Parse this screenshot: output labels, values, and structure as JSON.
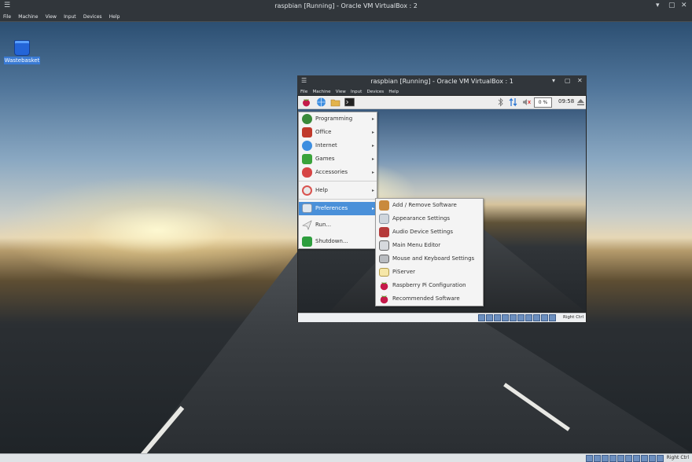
{
  "outer_window": {
    "title": "raspbian [Running] - Oracle VM VirtualBox : 2",
    "menu": [
      "File",
      "Machine",
      "View",
      "Input",
      "Devices",
      "Help"
    ],
    "controls": [
      "minimize-icon",
      "maximize-icon",
      "close-icon"
    ]
  },
  "outer_desktop": {
    "icons": [
      {
        "label": "Wastebasket",
        "icon": "trash-icon"
      }
    ]
  },
  "outer_status": {
    "host_key": "Right Ctrl"
  },
  "inner_window": {
    "title": "raspbian [Running] - Oracle VM VirtualBox : 1",
    "menu": [
      "File",
      "Machine",
      "View",
      "Input",
      "Devices",
      "Help"
    ],
    "controls": [
      "minimize-icon",
      "maximize-icon",
      "close-icon"
    ]
  },
  "panel": {
    "launchers": [
      "raspberry-menu-icon",
      "web-browser-icon",
      "file-manager-icon",
      "terminal-icon"
    ],
    "tray": [
      "bluetooth-icon",
      "network-icon",
      "volume-muted-icon"
    ],
    "cpu_label": "0 %",
    "clock": "09:58",
    "eject_icon": "eject-icon"
  },
  "app_menu": {
    "items": [
      {
        "label": "Programming",
        "icon": "programming-icon",
        "submenu": true
      },
      {
        "label": "Office",
        "icon": "office-icon",
        "submenu": true
      },
      {
        "label": "Internet",
        "icon": "internet-icon",
        "submenu": true
      },
      {
        "label": "Games",
        "icon": "games-icon",
        "submenu": true
      },
      {
        "label": "Accessories",
        "icon": "accessories-icon",
        "submenu": true
      },
      {
        "label": "Help",
        "icon": "help-icon",
        "submenu": true
      },
      {
        "label": "Preferences",
        "icon": "preferences-icon",
        "submenu": true,
        "selected": true
      },
      {
        "label": "Run...",
        "icon": "run-icon",
        "submenu": false
      },
      {
        "label": "Shutdown...",
        "icon": "shutdown-icon",
        "submenu": false
      }
    ]
  },
  "preferences_submenu": {
    "items": [
      {
        "label": "Add / Remove Software",
        "icon": "package-icon"
      },
      {
        "label": "Appearance Settings",
        "icon": "appearance-icon"
      },
      {
        "label": "Audio Device Settings",
        "icon": "audio-icon"
      },
      {
        "label": "Main Menu Editor",
        "icon": "menu-editor-icon"
      },
      {
        "label": "Mouse and Keyboard Settings",
        "icon": "keyboard-icon"
      },
      {
        "label": "PiServer",
        "icon": "piserver-icon"
      },
      {
        "label": "Raspberry Pi Configuration",
        "icon": "raspberry-icon"
      },
      {
        "label": "Recommended Software",
        "icon": "raspberry-icon"
      }
    ]
  },
  "inner_status": {
    "host_key": "Right Ctrl"
  }
}
